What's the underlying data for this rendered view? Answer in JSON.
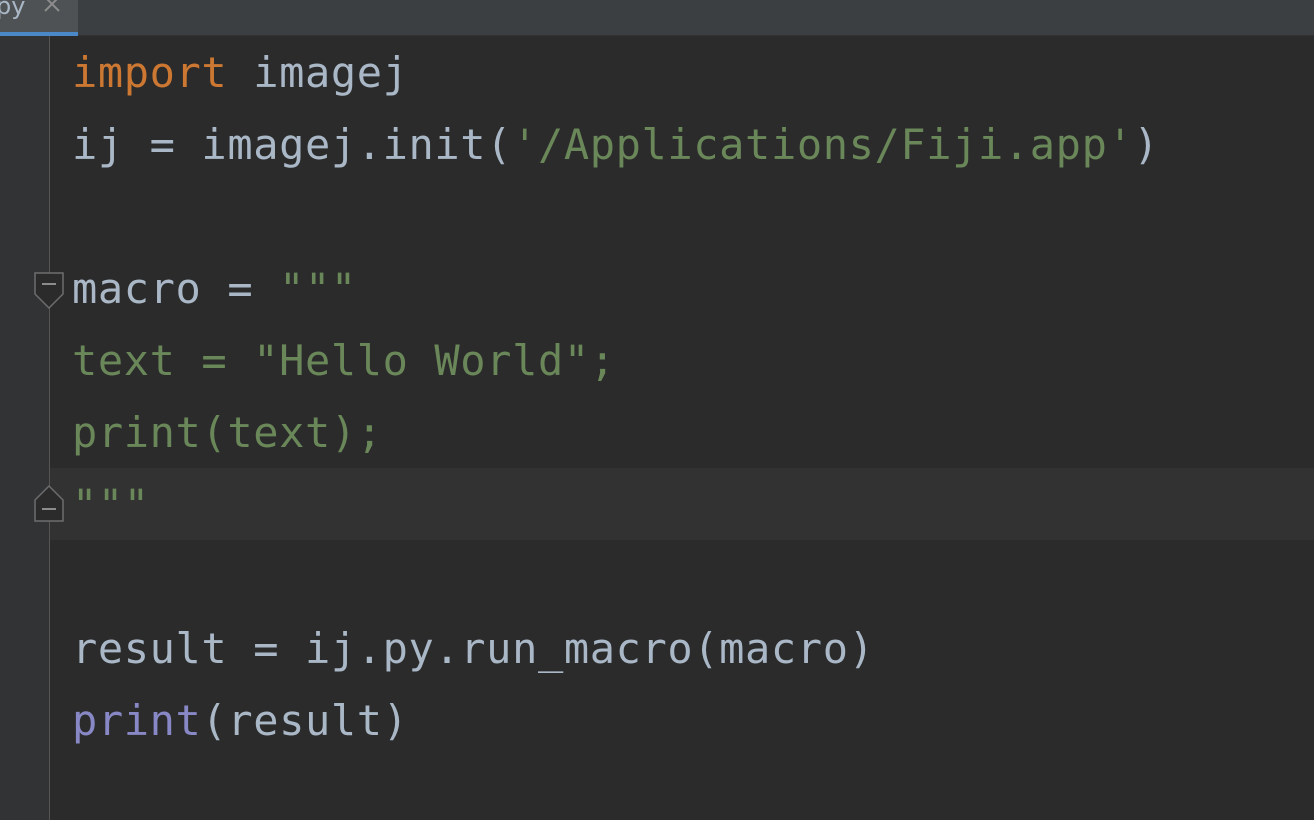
{
  "tab": {
    "label": "py"
  },
  "icons": {
    "close": "close-icon",
    "fold_start": "fold-start-icon",
    "fold_end": "fold-end-icon"
  },
  "colors": {
    "background": "#2b2b2b",
    "keyword": "#cc7832",
    "string": "#6a8759",
    "builtin": "#8888c6",
    "identifier": "#a9b7c6",
    "tab_accent": "#4a88c7"
  },
  "code": {
    "line1": {
      "kw": "import",
      "rest": " imagej"
    },
    "line2": {
      "pre": "ij = imagej.init(",
      "str": "'/Applications/Fiji.app'",
      "post": ")"
    },
    "line3": "",
    "line4": {
      "pre": "macro = ",
      "str": "\"\"\""
    },
    "line5": {
      "str": "text = \"Hello World\";"
    },
    "line6": {
      "str": "print(text);"
    },
    "line7": {
      "str": "\"\"\""
    },
    "line8": "",
    "line9": {
      "pre": "result = ij.py.run_macro(macro)"
    },
    "line10": {
      "builtin": "print",
      "post": "(result)"
    }
  }
}
